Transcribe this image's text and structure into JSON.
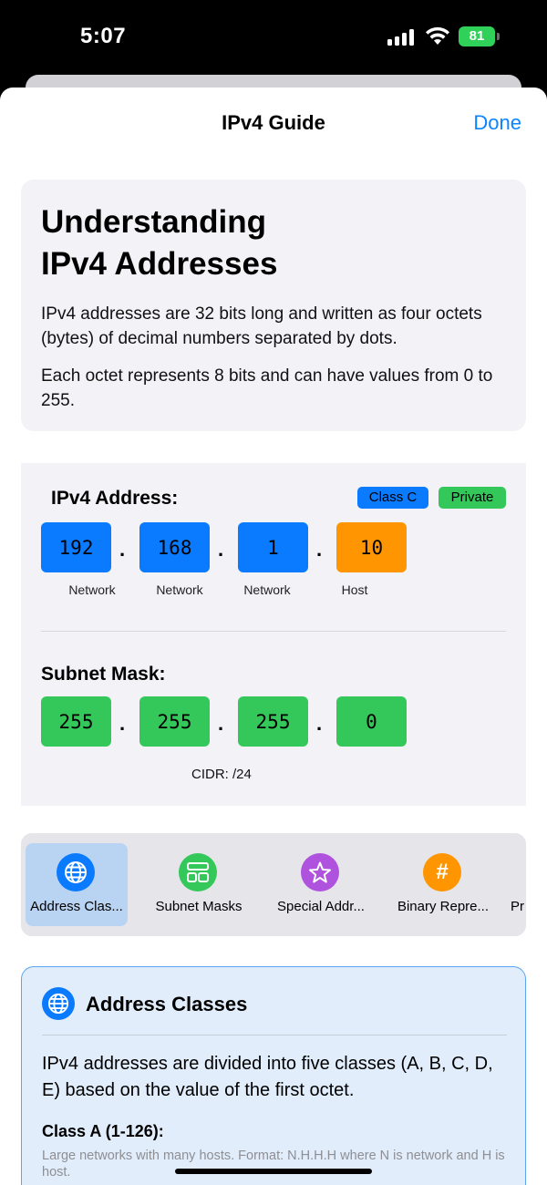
{
  "status_bar": {
    "time": "5:07",
    "battery": "81"
  },
  "nav": {
    "title": "IPv4 Guide",
    "done_label": "Done"
  },
  "intro": {
    "title_line1": "Understanding",
    "title_line2": "IPv4 Addresses",
    "para1": "IPv4 addresses are 32 bits long and written as four octets (bytes) of decimal numbers separated by dots.",
    "para2": "Each octet represents 8 bits and can have values from 0 to 255."
  },
  "address": {
    "label": "IPv4 Address:",
    "class_badge": "Class C",
    "type_badge": "Private",
    "octets": [
      {
        "value": "192",
        "role": "Network"
      },
      {
        "value": "168",
        "role": "Network"
      },
      {
        "value": "1",
        "role": "Network"
      },
      {
        "value": "10",
        "role": "Host"
      }
    ],
    "separator": "."
  },
  "mask": {
    "label": "Subnet Mask:",
    "octets": [
      "255",
      "255",
      "255",
      "0"
    ],
    "cidr": "CIDR: /24"
  },
  "tabs": [
    {
      "label": "Address Clas...",
      "icon": "globe-icon",
      "color": "#0a7aff",
      "active": true
    },
    {
      "label": "Subnet Masks",
      "icon": "network-icon",
      "color": "#34c759",
      "active": false
    },
    {
      "label": "Special Addr...",
      "icon": "star-icon",
      "color": "#af52de",
      "active": false
    },
    {
      "label": "Binary Repre...",
      "icon": "hash-icon",
      "color": "#ff9500",
      "active": false
    },
    {
      "label": "Pr",
      "icon": "",
      "color": "",
      "active": false
    }
  ],
  "detail": {
    "title": "Address Classes",
    "body": "IPv4 addresses are divided into five classes (A, B, C, D, E) based on the value of the first octet.",
    "class_title": "Class A (1-126):",
    "class_desc": "Large networks with many hosts. Format: N.H.H.H where N is network and H is host."
  },
  "colors": {
    "accent": "#0a84ff",
    "network": "#0a7aff",
    "host": "#ff9500",
    "mask": "#34c759"
  }
}
